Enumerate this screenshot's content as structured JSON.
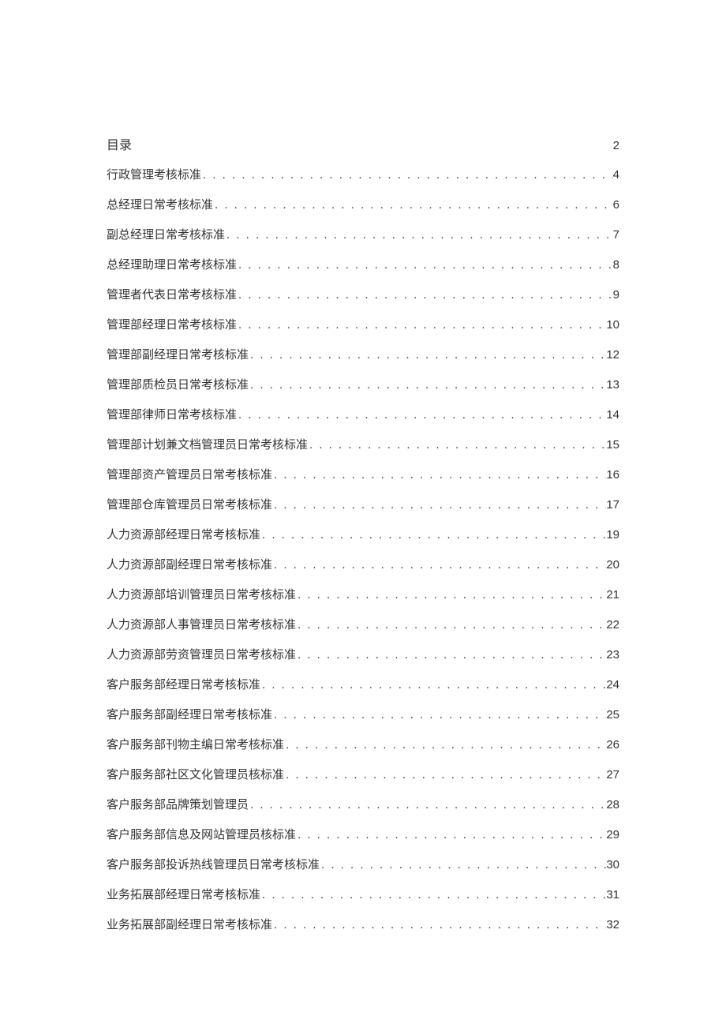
{
  "header": {
    "title": "目录",
    "page": "2"
  },
  "entries": [
    {
      "title": "行政管理考核标准",
      "page": "4",
      "prefix": "",
      "suffix_neg": true
    },
    {
      "title": "总经理日常考核标准",
      "page": "6"
    },
    {
      "title": "副总经理日常考核标准",
      "page": "7"
    },
    {
      "title": "总经理助理日常考核标准",
      "page": "8",
      "suffix_neg": true
    },
    {
      "title": "管理者代表日常考核标准",
      "page": "9"
    },
    {
      "title": "管理部经理日常考核标准",
      "page": "10"
    },
    {
      "title": "管理部副经理日常考核标准",
      "page": "12"
    },
    {
      "title": "管理部质检员日常考核标准",
      "page": "13"
    },
    {
      "title": "管理部律师日常考核标准",
      "page": "14"
    },
    {
      "title": "管理部计划兼文档管理员日常考核标准",
      "page": "15"
    },
    {
      "title": "管理部资产管理员日常考核标准",
      "page": "16"
    },
    {
      "title": "管理部仓库管理员日常考核标准",
      "page": "17"
    },
    {
      "title": "人力资源部经理日常考核标准",
      "page": "19"
    },
    {
      "title": "人力资源部副经理日常考核标准",
      "page": "20"
    },
    {
      "title": "人力资源部培训管理员日常考核标准",
      "page": "21"
    },
    {
      "title": "人力资源部人事管理员日常考核标准",
      "page": "22"
    },
    {
      "title": "人力资源部劳资管理员日常考核标准",
      "page": "23"
    },
    {
      "title": "客户服务部经理日常考核标准",
      "page": "24"
    },
    {
      "title": "客户服务部副经理日常考核标准",
      "page": "25"
    },
    {
      "title": "客户服务部刊物主编日常考核标准",
      "page": "26"
    },
    {
      "title": "客户服务部社区文化管理员核标准",
      "page": "27"
    },
    {
      "title": "客户服务部品牌策划管理员",
      "page": "28"
    },
    {
      "title": "客户服务部信息及网站管理员核标准",
      "page": "29"
    },
    {
      "title": "客户服务部投诉热线管理员日常考核标准",
      "page": "30"
    },
    {
      "title": "业务拓展部经理日常考核标准",
      "page": "31"
    },
    {
      "title": "业务拓展部副经理日常考核标准",
      "page": "32"
    }
  ],
  "dots": ". . . . . . . . . . . . . . . . . . . . . . . . . . . . . . . . . . . . . . . . . . . . . . . . . . . . . . . . . . . . . . . . . . . . . . . . . . . . . . . . . . . . . . . . . . . . . . . . . . . ."
}
